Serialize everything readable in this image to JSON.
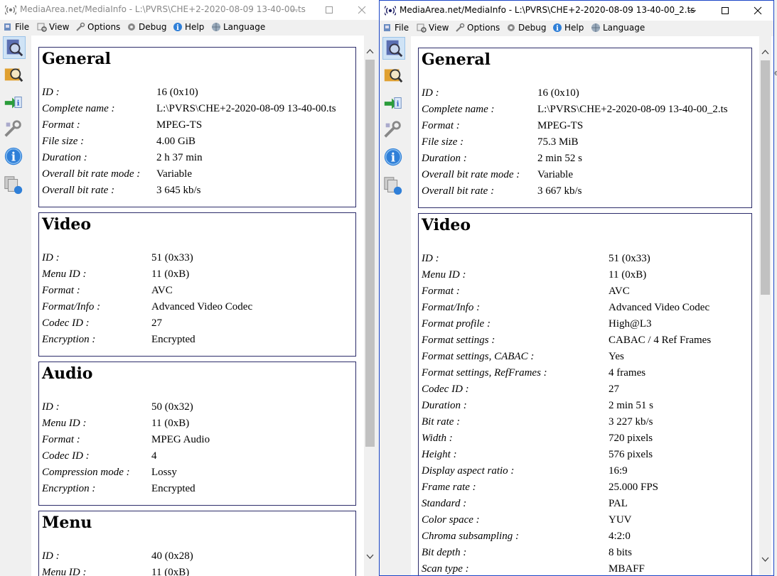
{
  "left_window": {
    "title": "MediaArea.net/MediaInfo - L:\\PVRS\\CHE+2-2020-08-09 13-40-00.ts",
    "menu": [
      "File",
      "View",
      "Options",
      "Debug",
      "Help",
      "Language"
    ],
    "sections": [
      {
        "title": "General",
        "rows": [
          {
            "k": "ID :",
            "v": "16 (0x10)"
          },
          {
            "k": "Complete name :",
            "v": "L:\\PVRS\\CHE+2-2020-08-09 13-40-00.ts"
          },
          {
            "k": "Format :",
            "v": "MPEG-TS"
          },
          {
            "k": "File size :",
            "v": "4.00 GiB"
          },
          {
            "k": "Duration :",
            "v": "2 h 37 min"
          },
          {
            "k": "Overall bit rate mode :",
            "v": "Variable"
          },
          {
            "k": "Overall bit rate :",
            "v": "3 645 kb/s"
          }
        ]
      },
      {
        "title": "Video",
        "rows": [
          {
            "k": "ID :",
            "v": "51 (0x33)"
          },
          {
            "k": "Menu ID :",
            "v": "11 (0xB)"
          },
          {
            "k": "Format :",
            "v": "AVC"
          },
          {
            "k": "Format/Info :",
            "v": "Advanced Video Codec"
          },
          {
            "k": "Codec ID :",
            "v": "27"
          },
          {
            "k": "Encryption :",
            "v": "Encrypted"
          }
        ]
      },
      {
        "title": "Audio",
        "rows": [
          {
            "k": "ID :",
            "v": "50 (0x32)"
          },
          {
            "k": "Menu ID :",
            "v": "11 (0xB)"
          },
          {
            "k": "Format :",
            "v": "MPEG Audio"
          },
          {
            "k": "Codec ID :",
            "v": "4"
          },
          {
            "k": "Compression mode :",
            "v": "Lossy"
          },
          {
            "k": "Encryption :",
            "v": "Encrypted"
          }
        ]
      },
      {
        "title": "Menu",
        "rows": [
          {
            "k": "ID :",
            "v": "40 (0x28)"
          },
          {
            "k": "Menu ID :",
            "v": "11 (0xB)"
          }
        ]
      }
    ]
  },
  "right_window": {
    "title": "MediaArea.net/MediaInfo - L:\\PVRS\\CHE+2-2020-08-09 13-40-00_2.ts",
    "menu": [
      "File",
      "View",
      "Options",
      "Debug",
      "Help",
      "Language"
    ],
    "sections": [
      {
        "title": "General",
        "rows": [
          {
            "k": "ID :",
            "v": "16 (0x10)"
          },
          {
            "k": "Complete name :",
            "v": "L:\\PVRS\\CHE+2-2020-08-09 13-40-00_2.ts"
          },
          {
            "k": "Format :",
            "v": "MPEG-TS"
          },
          {
            "k": "File size :",
            "v": "75.3 MiB"
          },
          {
            "k": "Duration :",
            "v": "2 min 52 s"
          },
          {
            "k": "Overall bit rate mode :",
            "v": "Variable"
          },
          {
            "k": "Overall bit rate :",
            "v": "3 667 kb/s"
          }
        ]
      },
      {
        "title": "Video",
        "rows": [
          {
            "k": "ID :",
            "v": "51 (0x33)"
          },
          {
            "k": "Menu ID :",
            "v": "11 (0xB)"
          },
          {
            "k": "Format :",
            "v": "AVC"
          },
          {
            "k": "Format/Info :",
            "v": "Advanced Video Codec"
          },
          {
            "k": "Format profile :",
            "v": "High@L3"
          },
          {
            "k": "Format settings :",
            "v": "CABAC / 4 Ref Frames"
          },
          {
            "k": "Format settings, CABAC :",
            "v": "Yes"
          },
          {
            "k": "Format settings, RefFrames :",
            "v": "4 frames"
          },
          {
            "k": "Codec ID :",
            "v": "27"
          },
          {
            "k": "Duration :",
            "v": "2 min 51 s"
          },
          {
            "k": "Bit rate :",
            "v": "3 227 kb/s"
          },
          {
            "k": "Width :",
            "v": "720 pixels"
          },
          {
            "k": "Height :",
            "v": "576 pixels"
          },
          {
            "k": "Display aspect ratio :",
            "v": "16:9"
          },
          {
            "k": "Frame rate :",
            "v": "25.000 FPS"
          },
          {
            "k": "Standard :",
            "v": "PAL"
          },
          {
            "k": "Color space :",
            "v": "YUV"
          },
          {
            "k": "Chroma subsampling :",
            "v": "4:2:0"
          },
          {
            "k": "Bit depth :",
            "v": "8 bits"
          },
          {
            "k": "Scan type :",
            "v": "MBAFF"
          }
        ]
      }
    ]
  },
  "edge_text": "e",
  "colors": {
    "active_border": "#1a45c6",
    "section_border": "#2c2c6a"
  }
}
